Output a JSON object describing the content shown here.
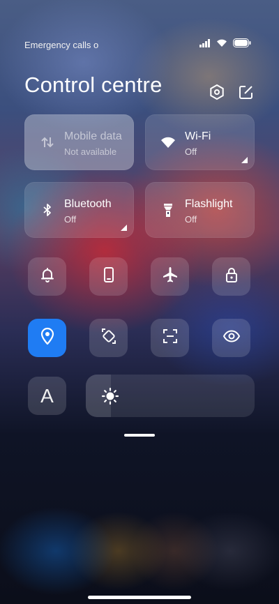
{
  "status_bar": {
    "carrier_text": "Emergency calls o",
    "icons": [
      "signal-icon",
      "wifi-icon",
      "battery-icon"
    ]
  },
  "header": {
    "title": "Control centre",
    "actions": [
      "settings-icon",
      "edit-icon"
    ]
  },
  "tiles": [
    {
      "name": "Mobile data",
      "state": "Not available",
      "icon": "mobile-data-icon",
      "enabled": false
    },
    {
      "name": "Wi-Fi",
      "state": "Off",
      "icon": "wifi-icon",
      "enabled": true
    },
    {
      "name": "Bluetooth",
      "state": "Off",
      "icon": "bluetooth-icon",
      "enabled": true
    },
    {
      "name": "Flashlight",
      "state": "Off",
      "icon": "flashlight-icon",
      "enabled": true
    }
  ],
  "toggles_row1": [
    "bell-icon",
    "phone-icon",
    "airplane-icon",
    "lock-icon"
  ],
  "toggles_row2": [
    "location-icon",
    "auto-rotate-icon",
    "screenshot-icon",
    "eye-icon"
  ],
  "font_button": {
    "label": "A"
  },
  "brightness": {
    "icon": "sun-icon",
    "level": 0.15
  },
  "colors": {
    "accent": "#1f7cf3"
  }
}
